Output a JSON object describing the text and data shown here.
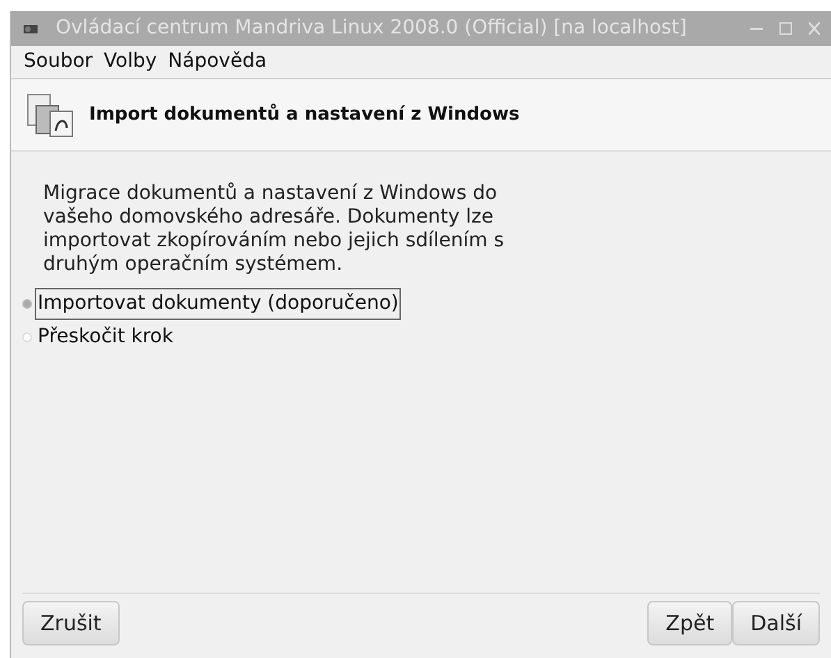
{
  "window": {
    "title": "Ovládací centrum Mandriva Linux 2008.0 (Official) [na localhost]"
  },
  "menu": [
    "Soubor",
    "Volby",
    "Nápověda"
  ],
  "header": {
    "title": "Import dokumentů a nastavení z Windows"
  },
  "description": "Migrace dokumentů a nastavení z Windows do vašeho domovského adresáře. Dokumenty lze importovat zkopírováním nebo jejich sdílením s druhým operačním systémem.",
  "options": [
    {
      "label": "Importovat dokumenty (doporučeno)",
      "selected": true
    },
    {
      "label": "Přeskočit krok",
      "selected": false
    }
  ],
  "buttons_left": [
    "Zrušit"
  ],
  "buttons_right": [
    "Zpět",
    "Další"
  ]
}
